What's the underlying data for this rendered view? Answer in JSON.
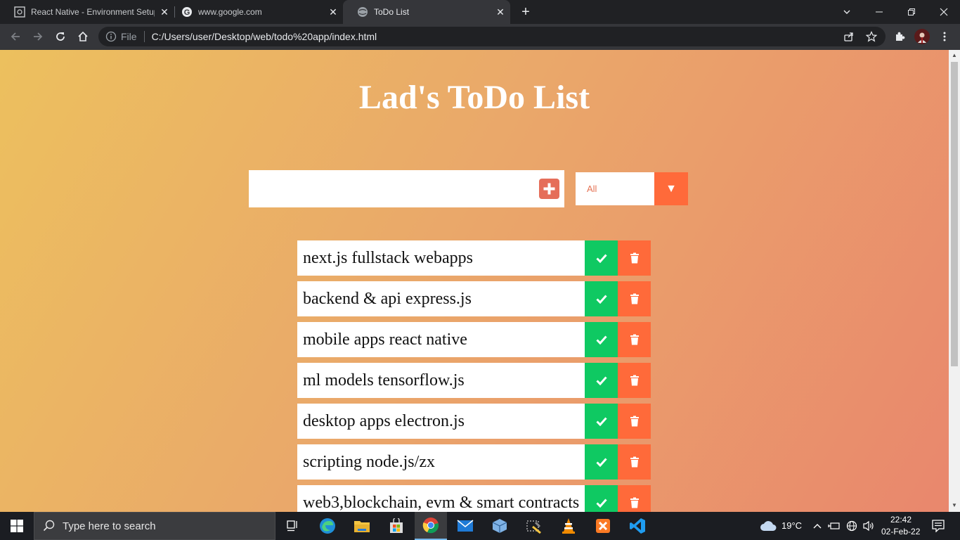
{
  "browser": {
    "tabs": [
      {
        "title": "React Native - Environment Setup",
        "active": false
      },
      {
        "title": "www.google.com",
        "active": false
      },
      {
        "title": "ToDo List",
        "active": true
      }
    ],
    "address_scheme": "File",
    "address_url": "C:/Users/user/Desktop/web/todo%20app/index.html"
  },
  "app": {
    "title": "Lad's ToDo List",
    "input_value": "",
    "filter_selected": "All",
    "todos": [
      {
        "text": "next.js fullstack webapps"
      },
      {
        "text": "backend & api express.js"
      },
      {
        "text": "mobile apps react native"
      },
      {
        "text": "ml models tensorflow.js"
      },
      {
        "text": "desktop apps electron.js"
      },
      {
        "text": "scripting node.js/zx"
      },
      {
        "text": "web3,blockchain, evm & smart contracts"
      }
    ],
    "colors": {
      "complete": "#0fc962",
      "delete": "#ff6a3a",
      "add": "#e56e5a"
    }
  },
  "taskbar": {
    "search_placeholder": "Type here to search",
    "temperature": "19°C",
    "time": "22:42",
    "date": "02-Feb-22"
  }
}
